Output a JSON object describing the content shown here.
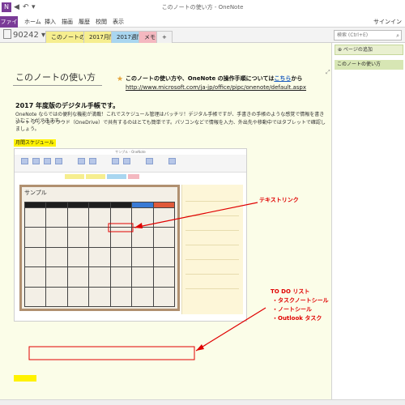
{
  "titlebar": {
    "app_badge": "N",
    "title": "このノートの使い方 - OneNote",
    "quick_access": [
      "◀",
      "↶",
      "▾"
    ]
  },
  "ribbon": {
    "file": "ファイル",
    "tabs": [
      "ホーム",
      "挿入",
      "描画",
      "履歴",
      "校閲",
      "表示"
    ],
    "signin": "サインイン"
  },
  "notebook": {
    "name": "90242",
    "dropdown": "▾"
  },
  "sections": [
    {
      "label": "このノートの使い方",
      "color": "#f6ee8f"
    },
    {
      "label": "2017月間",
      "color": "#f6ee8f"
    },
    {
      "label": "2017週間",
      "color": "#a9d6f0"
    },
    {
      "label": "メモ",
      "color": "#f4b8c0"
    },
    {
      "label": "+",
      "color": "#f1f1f1"
    }
  ],
  "search": {
    "placeholder": "検索 (Ctrl+E)",
    "icon": "⌕"
  },
  "page": {
    "title": "このノートの使い方",
    "note_prefix": "このノートの使い方や、OneNote の操作手順については",
    "note_link": "こちら",
    "note_suffix": "から",
    "url": "http://www.microsoft.com/ja-jp/office/pipc/onenote/default.aspx",
    "star": "★",
    "heading": "2017 年度版のデジタル手帳です。",
    "body_line1": "OneNote ならではの便利な機能が満載！これでスケジュール管理はバッチリ！デジタル手帳ですが、手書きの手帳のような感覚で情報を書き込むことができます。",
    "body_line2": "ノート ブックをクラウド（OneDrive）で共有するのはとても簡単です。パソコンなどで情報を入力、外出先や移動中ではタブレットで確認しましょう。",
    "highlight_label": "月間スケジュール",
    "resize_icon": "⤢"
  },
  "screenshot": {
    "window_title": "サンプル - OneNote",
    "sheet_title": "サンプル",
    "todo_icon": "✎"
  },
  "annotations": {
    "text_link": "テキストリンク",
    "todo_title": "TO DO リスト",
    "todo_1": "・タスクノートシール",
    "todo_2": "・ノートシール",
    "todo_3": "・Outlook タスク"
  },
  "right_pane": {
    "add_page": "⊕ ページの追加",
    "current_page": "このノートの使い方"
  },
  "colors": {
    "accent": "#7a3b97",
    "page_bg": "#fbfde8",
    "annotation": "#e00000",
    "highlight": "#fff200"
  }
}
